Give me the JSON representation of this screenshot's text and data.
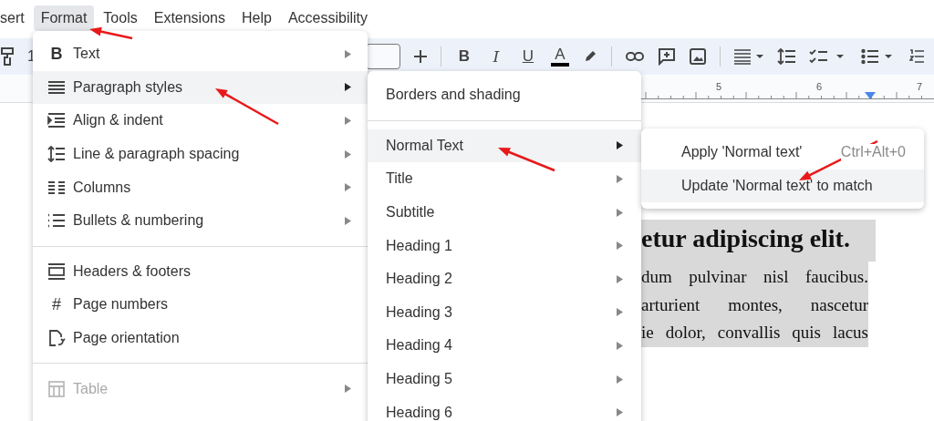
{
  "menu_bar": [
    {
      "label": "sert",
      "selected": false
    },
    {
      "label": "Format",
      "selected": true
    },
    {
      "label": "Tools",
      "selected": false
    },
    {
      "label": "Extensions",
      "selected": false
    },
    {
      "label": "Help",
      "selected": false
    },
    {
      "label": "Accessibility",
      "selected": false
    }
  ],
  "toolbar": {
    "zoom": "1",
    "format_buttons": [
      "B",
      "I",
      "U",
      "A"
    ]
  },
  "ruler": {
    "numbers": [
      "5",
      "6",
      "7"
    ]
  },
  "format_menu": {
    "sections": [
      [
        {
          "label": "Text",
          "glyph": "B",
          "has_submenu": true,
          "selected": false,
          "disabled": false
        },
        {
          "label": "Paragraph styles",
          "has_submenu": true,
          "selected": true,
          "disabled": false
        },
        {
          "label": "Align & indent",
          "has_submenu": true,
          "selected": false,
          "disabled": false
        },
        {
          "label": "Line & paragraph spacing",
          "has_submenu": true,
          "selected": false,
          "disabled": false
        },
        {
          "label": "Columns",
          "has_submenu": true,
          "selected": false,
          "disabled": false
        },
        {
          "label": "Bullets & numbering",
          "has_submenu": true,
          "selected": false,
          "disabled": false
        }
      ],
      [
        {
          "label": "Headers & footers",
          "has_submenu": false,
          "selected": false,
          "disabled": false
        },
        {
          "label": "Page numbers",
          "glyph": "#",
          "has_submenu": false,
          "selected": false,
          "disabled": false
        },
        {
          "label": "Page orientation",
          "has_submenu": false,
          "selected": false,
          "disabled": false
        }
      ],
      [
        {
          "label": "Table",
          "has_submenu": true,
          "selected": false,
          "disabled": true
        }
      ]
    ]
  },
  "paragraph_styles_menu": {
    "sections": [
      [
        {
          "label": "Borders and shading",
          "has_submenu": false,
          "selected": false
        }
      ],
      [
        {
          "label": "Normal Text",
          "has_submenu": true,
          "selected": true
        },
        {
          "label": "Title",
          "has_submenu": true,
          "selected": false
        },
        {
          "label": "Subtitle",
          "has_submenu": true,
          "selected": false
        },
        {
          "label": "Heading 1",
          "has_submenu": true,
          "selected": false
        },
        {
          "label": "Heading 2",
          "has_submenu": true,
          "selected": false
        },
        {
          "label": "Heading 3",
          "has_submenu": true,
          "selected": false
        },
        {
          "label": "Heading 4",
          "has_submenu": true,
          "selected": false
        },
        {
          "label": "Heading 5",
          "has_submenu": true,
          "selected": false
        },
        {
          "label": "Heading 6",
          "has_submenu": true,
          "selected": false
        }
      ]
    ]
  },
  "normal_text_menu": {
    "items": [
      {
        "label": "Apply 'Normal text'",
        "shortcut": "Ctrl+Alt+0",
        "selected": false
      },
      {
        "label": "Update 'Normal text' to match",
        "selected": true
      }
    ]
  },
  "document": {
    "heading": "etur adipiscing elit.",
    "highlighted": true,
    "lines": [
      "dum pulvinar nisl faucibus.",
      "arturient montes, nascetur",
      "ie dolor, convallis quis lacus"
    ]
  }
}
